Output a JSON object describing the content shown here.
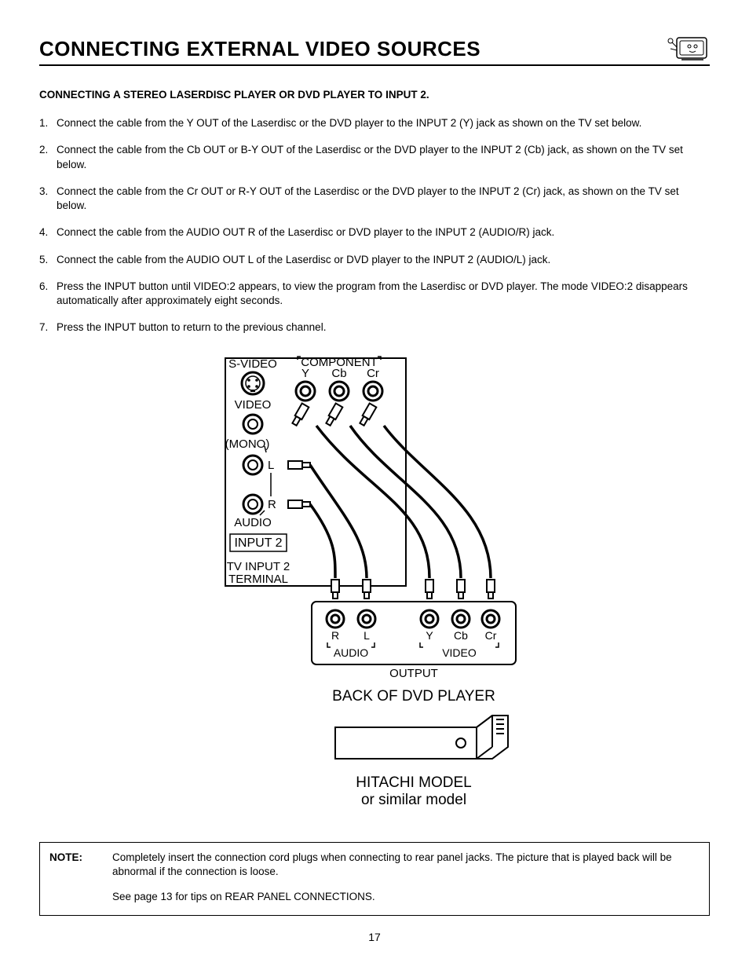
{
  "header": {
    "title": "CONNECTING EXTERNAL VIDEO SOURCES"
  },
  "subtitle": "CONNECTING A STEREO LASERDISC PLAYER OR DVD PLAYER TO INPUT 2.",
  "steps": [
    "Connect  the cable from the Y OUT of the Laserdisc or the DVD player to the INPUT 2 (Y) jack as shown on the TV set below.",
    "Connect the cable from the Cb OUT or B-Y OUT of the Laserdisc or the DVD player to the INPUT 2 (Cb) jack, as shown on the TV set below.",
    "Connect the cable from the Cr OUT or R-Y OUT of the Laserdisc or the DVD player to the INPUT 2 (Cr) jack, as shown on the TV set below.",
    "Connect the cable from the AUDIO OUT R of the Laserdisc or DVD player to the INPUT 2 (AUDIO/R) jack.",
    "Connect the cable from the AUDIO OUT L of the Laserdisc or DVD player to the INPUT 2 (AUDIO/L) jack.",
    "Press the INPUT button until VIDEO:2 appears, to view the program from the Laserdisc or DVD player.  The mode VIDEO:2 disappears automatically after approximately eight seconds.",
    "Press the INPUT button to return to the previous channel."
  ],
  "diagram": {
    "svideo_label": "S-VIDEO",
    "component_label": "COMPONENT",
    "y": "Y",
    "cb": "Cb",
    "cr": "Cr",
    "video_label": "VIDEO",
    "mono_label": "(MONO)",
    "l": "L",
    "r": "R",
    "audio_label": "AUDIO",
    "input2": "INPUT 2",
    "tv_input2_terminal_l1": "TV INPUT 2",
    "tv_input2_terminal_l2": "TERMINAL",
    "output": "OUTPUT",
    "back_dvd": "BACK OF DVD PLAYER",
    "hitachi_l1": "HITACHI MODEL",
    "hitachi_l2": "or similar model"
  },
  "note": {
    "label": "NOTE:",
    "text": "Completely insert the connection cord plugs when connecting to rear panel jacks.  The picture that is played back will be abnormal if the connection is loose.",
    "extra": "See page 13 for tips on REAR PANEL CONNECTIONS."
  },
  "page_number": "17"
}
